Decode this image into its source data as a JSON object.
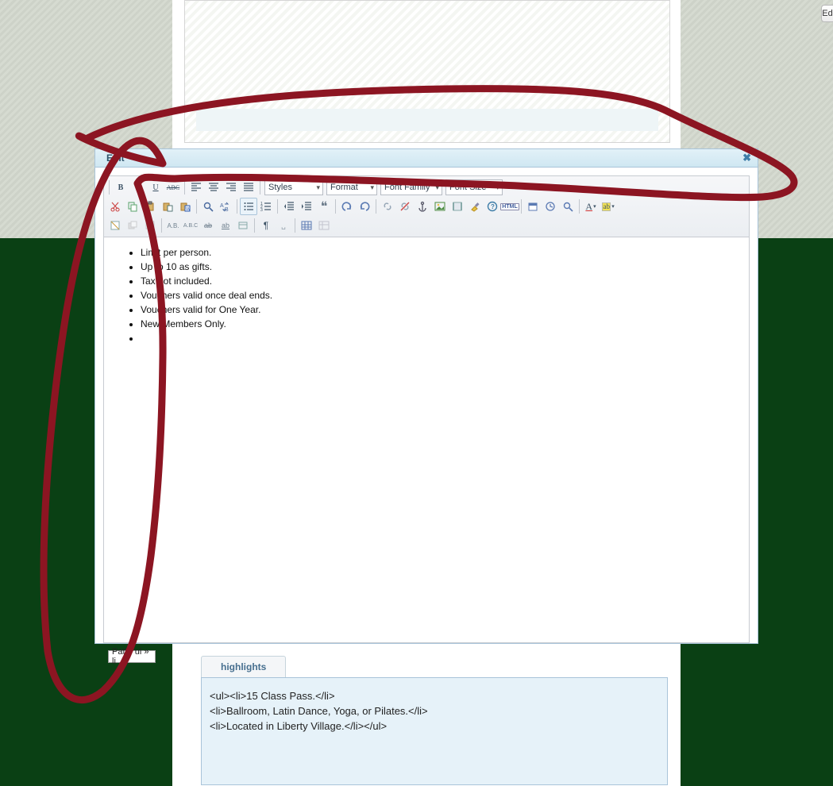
{
  "edit_window": {
    "title": "Edit",
    "close_glyph": "✖"
  },
  "side_button": {
    "label": "Ed"
  },
  "toolbar": {
    "selects": {
      "styles": "Styles",
      "format": "Format",
      "font_family": "Font Family",
      "font_size": "Font Size"
    },
    "row1": {
      "bold": "B",
      "italic": "I",
      "underline": "U",
      "strike": "ABC"
    },
    "html_label": "HTML"
  },
  "content": {
    "items": [
      "Limit per person.",
      "Up to 10 as gifts.",
      "Tax not included.",
      "Vouchers valid once deal ends.",
      "Vouchers valid for One Year.",
      "New Members Only.",
      ""
    ]
  },
  "path_bar": {
    "text": "Path: ul » li"
  },
  "tab": {
    "label": "highlights"
  },
  "highlights_raw": "<ul><li>15 Class Pass.</li>\n<li>Ballroom, Latin Dance, Yoga, or Pilates.</li>\n<li>Located in Liberty Village.</li></ul>",
  "colors": {
    "dark_green": "#0a4014",
    "annotation_red": "#8c1522",
    "panel_blue": "#e6f2f9"
  }
}
